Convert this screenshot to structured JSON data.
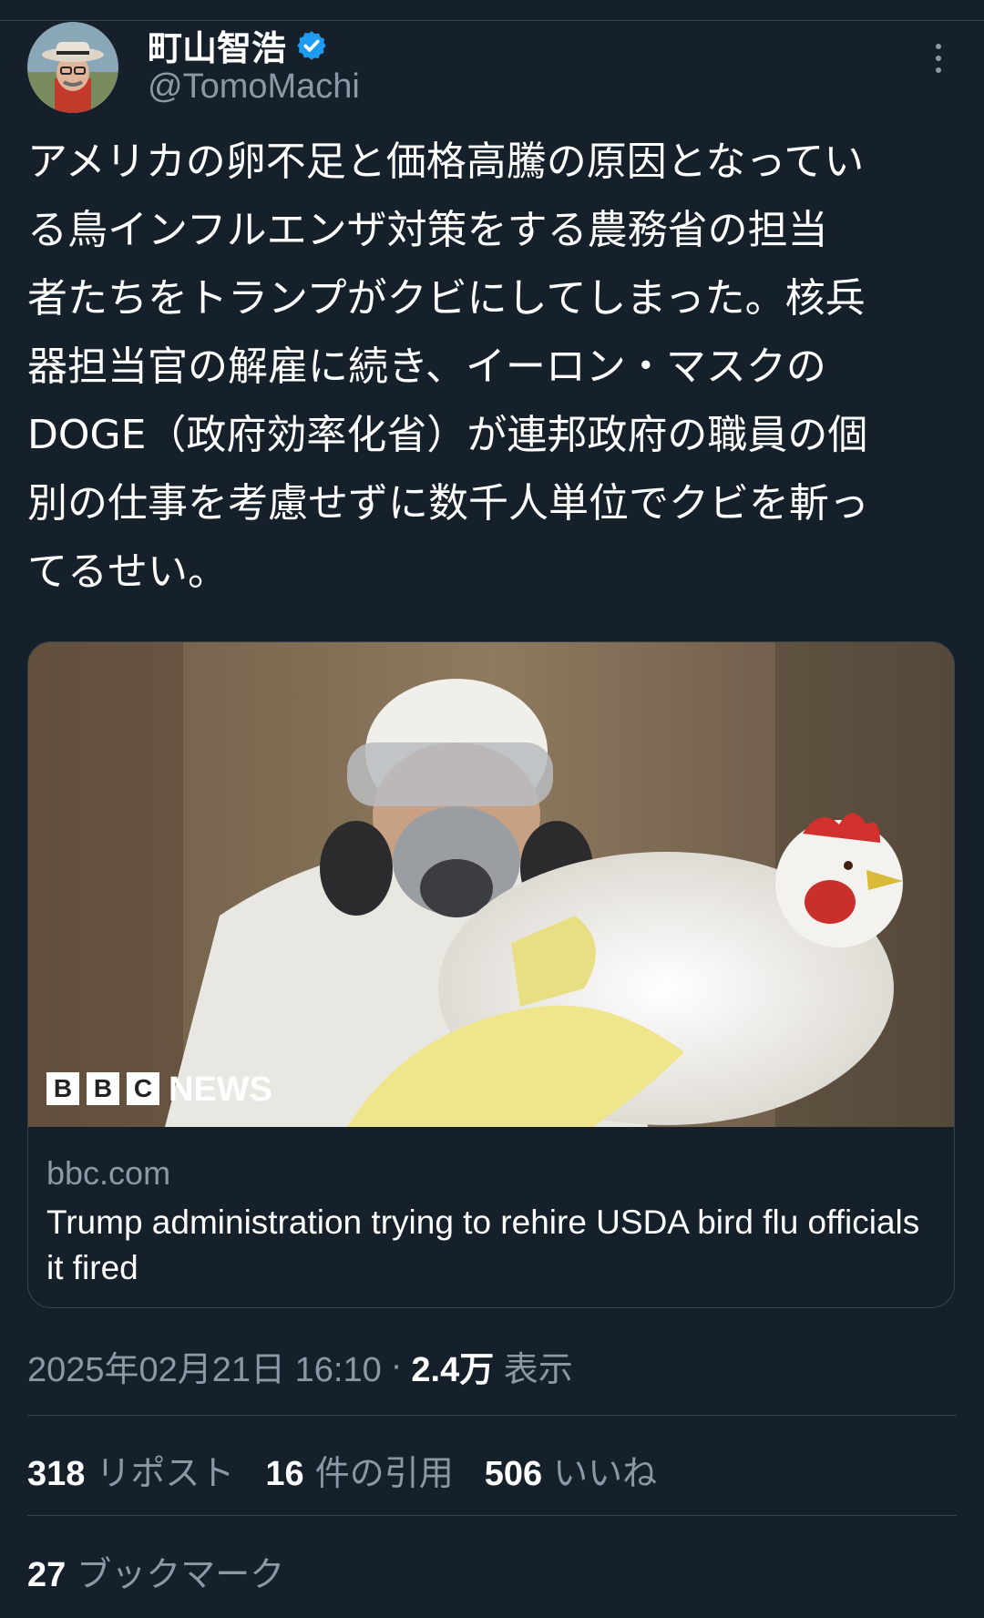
{
  "author": {
    "display_name": "町山智浩",
    "handle": "@TomoMachi"
  },
  "tweet": {
    "text": "アメリカの卵不足と価格高騰の原因となってい\nる鳥インフルエンザ対策をする農務省の担当\n者たちをトランプがクビにしてしまった。核兵\n器担当官の解雇に続き、イーロン・マスクの\nDOGE（政府効率化省）が連邦政府の職員の個\n別の仕事を考慮せずに数千人単位でクビを斬っ\nてるせい。"
  },
  "card": {
    "logo_text": "NEWS",
    "logo_letters": [
      "B",
      "B",
      "C"
    ],
    "domain": "bbc.com",
    "title": "Trump administration trying to rehire USDA bird flu officials it fired"
  },
  "meta": {
    "timestamp": "2025年02月21日 16:10",
    "separator": "·",
    "views_count": "2.4万",
    "views_label": "表示"
  },
  "stats": {
    "reposts_count": "318",
    "reposts_label": "リポスト",
    "quotes_count": "16",
    "quotes_label": "件の引用",
    "likes_count": "506",
    "likes_label": "いいね",
    "bookmarks_count": "27",
    "bookmarks_label": "ブックマーク"
  },
  "colors": {
    "background": "#15202b",
    "secondary_text": "#8b98a5",
    "border": "#38444d",
    "verified_blue": "#1d9bf0"
  }
}
